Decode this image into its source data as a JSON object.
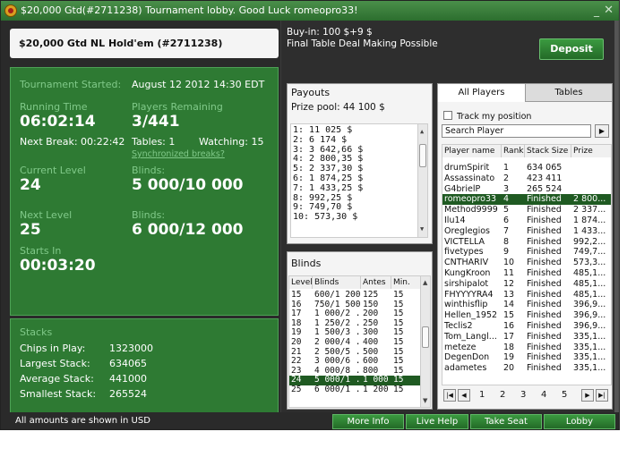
{
  "window": {
    "title": "$20,000 Gtd(#2711238) Tournament lobby. Good Luck romeopro33!",
    "min": "_",
    "close": "✕"
  },
  "tournament": {
    "name": "$20,000 Gtd NL Hold'em (#2711238)",
    "started_label": "Tournament Started:",
    "started_value": "August 12 2012  14:30 EDT",
    "running_label": "Running Time",
    "running_value": "06:02:14",
    "players_label": "Players Remaining",
    "players_value": "3/441",
    "next_break": "Next Break: 00:22:42",
    "tables": "Tables: 1",
    "watching": "Watching: 15",
    "sync_link": "Synchronized breaks?",
    "current_level_label": "Current Level",
    "current_level": "24",
    "blinds_label": "Blinds:",
    "blinds_value": "5 000/10 000",
    "next_level_label": "Next Level",
    "next_level": "25",
    "next_blinds_label": "Blinds:",
    "next_blinds": "6 000/12 000",
    "starts_in_label": "Starts In",
    "starts_in": "00:03:20"
  },
  "stacks": {
    "title": "Stacks",
    "rows": [
      {
        "label": "Chips in Play:",
        "value": "1323000"
      },
      {
        "label": "Largest Stack:",
        "value": "634065"
      },
      {
        "label": "Average Stack:",
        "value": "441000"
      },
      {
        "label": "Smallest Stack:",
        "value": "265524"
      }
    ]
  },
  "buyin": {
    "line1": "Buy-in: 100 $+9 $",
    "line2": "Final Table Deal Making Possible"
  },
  "deposit_label": "Deposit",
  "payouts": {
    "title": "Payouts",
    "prize_pool": "Prize pool: 44 100 $",
    "items": [
      "1: 11 025 $",
      "2: 6 174 $",
      "3: 3 642,66 $",
      "4: 2 800,35 $",
      "5: 2 337,30 $",
      "6: 1 874,25 $",
      "7: 1 433,25 $",
      "8: 992,25 $",
      "9: 749,70 $",
      "10: 573,30 $"
    ]
  },
  "blinds": {
    "title": "Blinds",
    "headers": [
      "Levels",
      "Blinds",
      "Antes",
      "Min."
    ],
    "rows": [
      [
        "15",
        "600/1 200",
        "125",
        "15"
      ],
      [
        "16",
        "750/1 500",
        "150",
        "15"
      ],
      [
        "17",
        "1 000/2 ..",
        "200",
        "15"
      ],
      [
        "18",
        "1 250/2 ..",
        "250",
        "15"
      ],
      [
        "19",
        "1 500/3 ..",
        "300",
        "15"
      ],
      [
        "20",
        "2 000/4 ..",
        "400",
        "15"
      ],
      [
        "21",
        "2 500/5 ..",
        "500",
        "15"
      ],
      [
        "22",
        "3 000/6 ..",
        "600",
        "15"
      ],
      [
        "23",
        "4 000/8 ..",
        "800",
        "15"
      ],
      [
        "24",
        "5 000/1 ..",
        "1 000",
        "15"
      ],
      [
        "25",
        "6 000/1 ..",
        "1 200",
        "15"
      ]
    ],
    "selected_index": 9
  },
  "players": {
    "tabs": [
      "All Players",
      "Tables"
    ],
    "track_label": "Track my position",
    "search_placeholder": "Search Player",
    "search_go": "▶",
    "headers": [
      "Player name",
      "Rank",
      "Stack Size",
      "Prize"
    ],
    "rows": [
      [
        "drumSpirit",
        "1",
        "634 065",
        ""
      ],
      [
        "Assassinato",
        "2",
        "423 411",
        ""
      ],
      [
        "G4brielP",
        "3",
        "265 524",
        ""
      ],
      [
        "romeopro33",
        "4",
        "Finished",
        "2 800..."
      ],
      [
        "Method9999",
        "5",
        "Finished",
        "2 337..."
      ],
      [
        "Ilu14",
        "6",
        "Finished",
        "1 874..."
      ],
      [
        "Oreglegios",
        "7",
        "Finished",
        "1 433..."
      ],
      [
        "VICTELLA",
        "8",
        "Finished",
        "992,2..."
      ],
      [
        "fivetypes",
        "9",
        "Finished",
        "749,7..."
      ],
      [
        "CNTHARIV",
        "10",
        "Finished",
        "573,3..."
      ],
      [
        "KungKroon",
        "11",
        "Finished",
        "485,1..."
      ],
      [
        "sirshipalot",
        "12",
        "Finished",
        "485,1..."
      ],
      [
        "FHYYYYRA4",
        "13",
        "Finished",
        "485,1..."
      ],
      [
        "winthisflip",
        "14",
        "Finished",
        "396,9..."
      ],
      [
        "Hellen_1952",
        "15",
        "Finished",
        "396,9..."
      ],
      [
        "Teclis2",
        "16",
        "Finished",
        "396,9..."
      ],
      [
        "Tom_Langl...",
        "17",
        "Finished",
        "335,1..."
      ],
      [
        "meteze",
        "18",
        "Finished",
        "335,1..."
      ],
      [
        "DegenDon",
        "19",
        "Finished",
        "335,1..."
      ],
      [
        "adametes",
        "20",
        "Finished",
        "335,1..."
      ]
    ],
    "selected_index": 3,
    "pages": [
      "1",
      "2",
      "3",
      "4",
      "5"
    ]
  },
  "footer": {
    "note": "All amounts are shown in USD",
    "buttons": [
      "More Info",
      "Live Help",
      "Take Seat",
      "Lobby"
    ]
  },
  "colors": {
    "panel_green": "#2e7a33",
    "label_green": "#80c989",
    "selected_row": "#1f5a22"
  }
}
